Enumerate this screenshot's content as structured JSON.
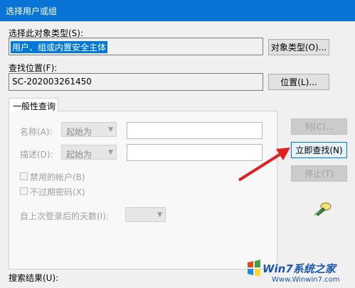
{
  "window": {
    "title": "选择用户或组"
  },
  "object_type": {
    "label": "选择此对象类型(S):",
    "value": "用户、组或内置安全主体",
    "button": "对象类型(O)..."
  },
  "location": {
    "label": "查找位置(F):",
    "value": "SC-202003261450",
    "button": "位置(L)..."
  },
  "tabs": [
    {
      "label": "一般性查询"
    }
  ],
  "query": {
    "name_label": "名称(A):",
    "name_mode": "起始为",
    "desc_label": "描述(D):",
    "desc_mode": "起始为",
    "disabled_accounts": "禁用的帐户(B)",
    "nonexpiring_password": "不过期密码(X)",
    "days_since_logon": "自上次登录后的天数(I):"
  },
  "buttons": {
    "columns": "列(C)...",
    "find_now": "立即查找(N)",
    "stop": "停止(T)"
  },
  "results": {
    "label": "搜索结果(U):"
  },
  "watermark": {
    "brand": "Win7系统之家",
    "url": "Www.Winwin7.com"
  },
  "colors": {
    "titlebar": "#0a74d6",
    "selection": "#0078d7",
    "arrow": "#e02020"
  },
  "icons": [
    "search-flashlight-icon",
    "windows-logo-icon"
  ]
}
